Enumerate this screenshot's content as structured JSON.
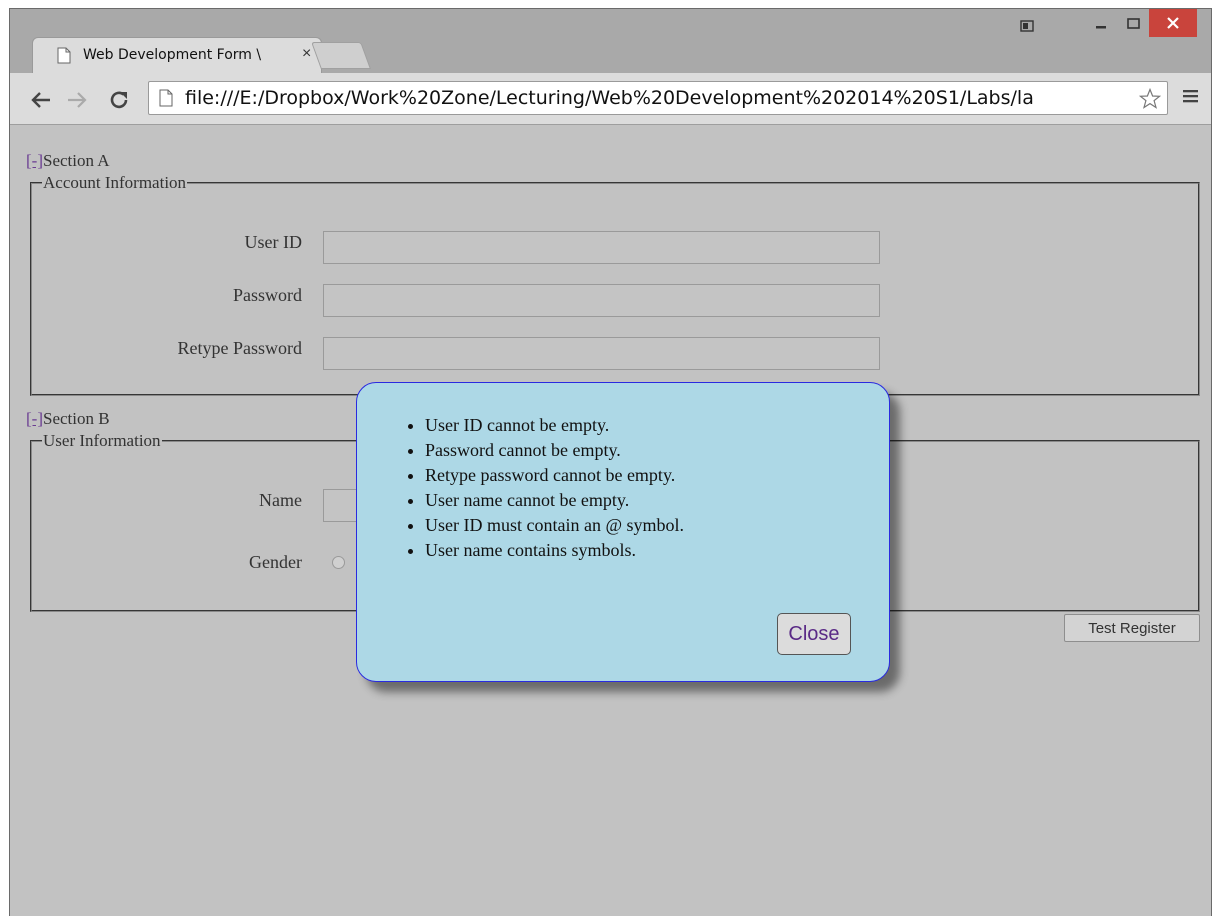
{
  "browser": {
    "tab_title": "Web Development Form \\",
    "tab_close": "×",
    "url": "file:///E:/Dropbox/Work%20Zone/Lecturing/Web%20Development%202014%20S1/Labs/la"
  },
  "section_a": {
    "toggle": "[-]",
    "heading": "Section A",
    "legend": "Account Information",
    "fields": [
      {
        "label": "User ID",
        "value": ""
      },
      {
        "label": "Password",
        "value": ""
      },
      {
        "label": "Retype Password",
        "value": ""
      }
    ]
  },
  "section_b": {
    "toggle": "[-]",
    "heading": "Section B",
    "legend": "User Information",
    "name_label": "Name",
    "gender_label": "Gender"
  },
  "test_register_label": "Test Register",
  "dialog": {
    "errors": [
      "User ID cannot be empty.",
      "Password cannot be empty.",
      "Retype password cannot be empty.",
      "User name cannot be empty.",
      "User ID must contain an @ symbol.",
      "User name contains symbols."
    ],
    "close_label": "Close"
  },
  "icons": {
    "tab": "page-icon",
    "back": "back-arrow-icon",
    "forward": "forward-arrow-icon",
    "reload": "reload-icon",
    "url": "file-icon",
    "bookmark": "star-icon",
    "menu": "hamburger-menu-icon"
  },
  "colors": {
    "page_background": "#c2c2c2",
    "dialog_background": "#add8e6",
    "dialog_border": "#2a2ae0",
    "close_button_text": "#5a2a86",
    "window_close": "#c9443c"
  }
}
